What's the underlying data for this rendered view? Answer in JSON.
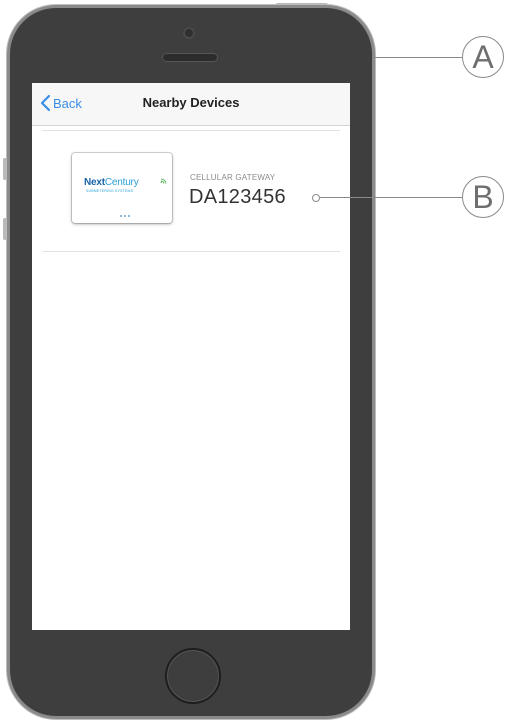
{
  "nav": {
    "back_label": "Back",
    "title": "Nearby Devices"
  },
  "devices": [
    {
      "type_label": "CELLULAR GATEWAY",
      "id": "DA123456",
      "logo": {
        "brand_primary": "Next",
        "brand_secondary": "Century",
        "tagline": "SUBMETERING SYSTEMS"
      }
    }
  ],
  "callouts": {
    "a": "A",
    "b": "B"
  },
  "icons": {
    "back": "chevron-left-icon",
    "signal": "wifi-signal-icon"
  },
  "colors": {
    "phone_body": "#3e3e3e",
    "accent_blue": "#3a8ee6",
    "brand_dark_blue": "#1a64a8",
    "brand_light_blue": "#2a9fd6",
    "signal_green": "#5cb85c"
  }
}
